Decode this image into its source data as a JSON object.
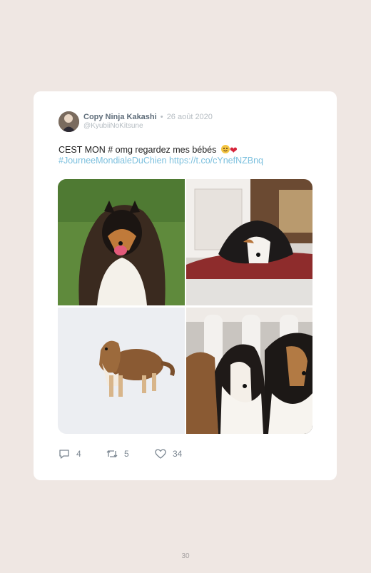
{
  "tweet": {
    "author_name": "Copy Ninja Kakashi",
    "separator": "•",
    "date": "26 août 2020",
    "handle": "@KyubiiNoKitsune",
    "text_main": "CEST MON # omg regardez mes bébés",
    "hashtag": "#JourneeMondialeDuChien",
    "link": "https://t.co/cYnefNZBnq",
    "emojis": [
      "grinning-face-icon",
      "red-heart-icon"
    ],
    "photos": [
      {
        "subject": "sheltie-on-grass"
      },
      {
        "subject": "sheltie-lying-on-blanket"
      },
      {
        "subject": "sheltie-in-snow"
      },
      {
        "subject": "three-shelties-by-balustrade"
      }
    ],
    "actions": {
      "replies": "4",
      "retweets": "5",
      "likes": "34"
    }
  },
  "page": {
    "number": "30"
  },
  "colors": {
    "background": "#efe7e3",
    "card": "#ffffff",
    "link": "#7cc0de",
    "muted": "#b5bcc2",
    "name": "#5f6d7a"
  }
}
